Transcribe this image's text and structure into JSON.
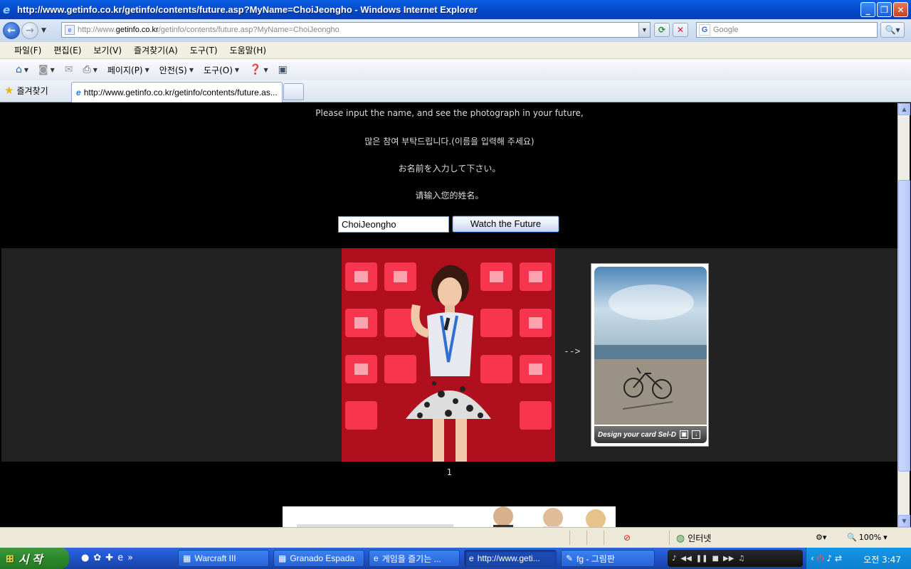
{
  "window": {
    "title": "http://www.getinfo.co.kr/getinfo/contents/future.asp?MyName=ChoiJeongho - Windows Internet Explorer"
  },
  "address": {
    "prefix": "http://www.",
    "host": "getinfo.co.kr",
    "path": "/getinfo/contents/future.asp?MyName=ChoiJeongho"
  },
  "search": {
    "placeholder": "Google"
  },
  "menu": [
    "파일(F)",
    "편집(E)",
    "보기(V)",
    "즐겨찾기(A)",
    "도구(T)",
    "도움말(H)"
  ],
  "commands": {
    "page": "페이지(P)",
    "safety": "안전(S)",
    "tools": "도구(O)"
  },
  "favorites_label": "즐겨찾기",
  "tab": {
    "title": "http://www.getinfo.co.kr/getinfo/contents/future.as..."
  },
  "content": {
    "line_en": "Please input the name, and see the photograph in your future,",
    "line_ko": "많은 참여 부탁드립니다.(이름을 입력해 주세요)",
    "line_ja": "お名前を入力して下さい。",
    "line_zh": "请输入您的姓名。",
    "name_value": "ChoiJeongho",
    "watch_button": "Watch the Future",
    "arrow": "-->",
    "card_caption": "Design your card Sel-D",
    "page_number": "1"
  },
  "status": {
    "zone": "인터넷",
    "zoom": "100%"
  },
  "taskbar": {
    "start": "시 작",
    "tasks": [
      {
        "label": "Warcraft III"
      },
      {
        "label": "Granado Espada"
      },
      {
        "label": "게임을 즐기는 ..."
      },
      {
        "label": "http://www.geti..."
      },
      {
        "label": "fg - 그림판"
      }
    ],
    "clock": "오전 3:47"
  },
  "colors": {
    "titlebar": "#0a5ee0",
    "content_bg": "#000000",
    "band_bg": "#222222",
    "taskbar": "#245edb"
  }
}
